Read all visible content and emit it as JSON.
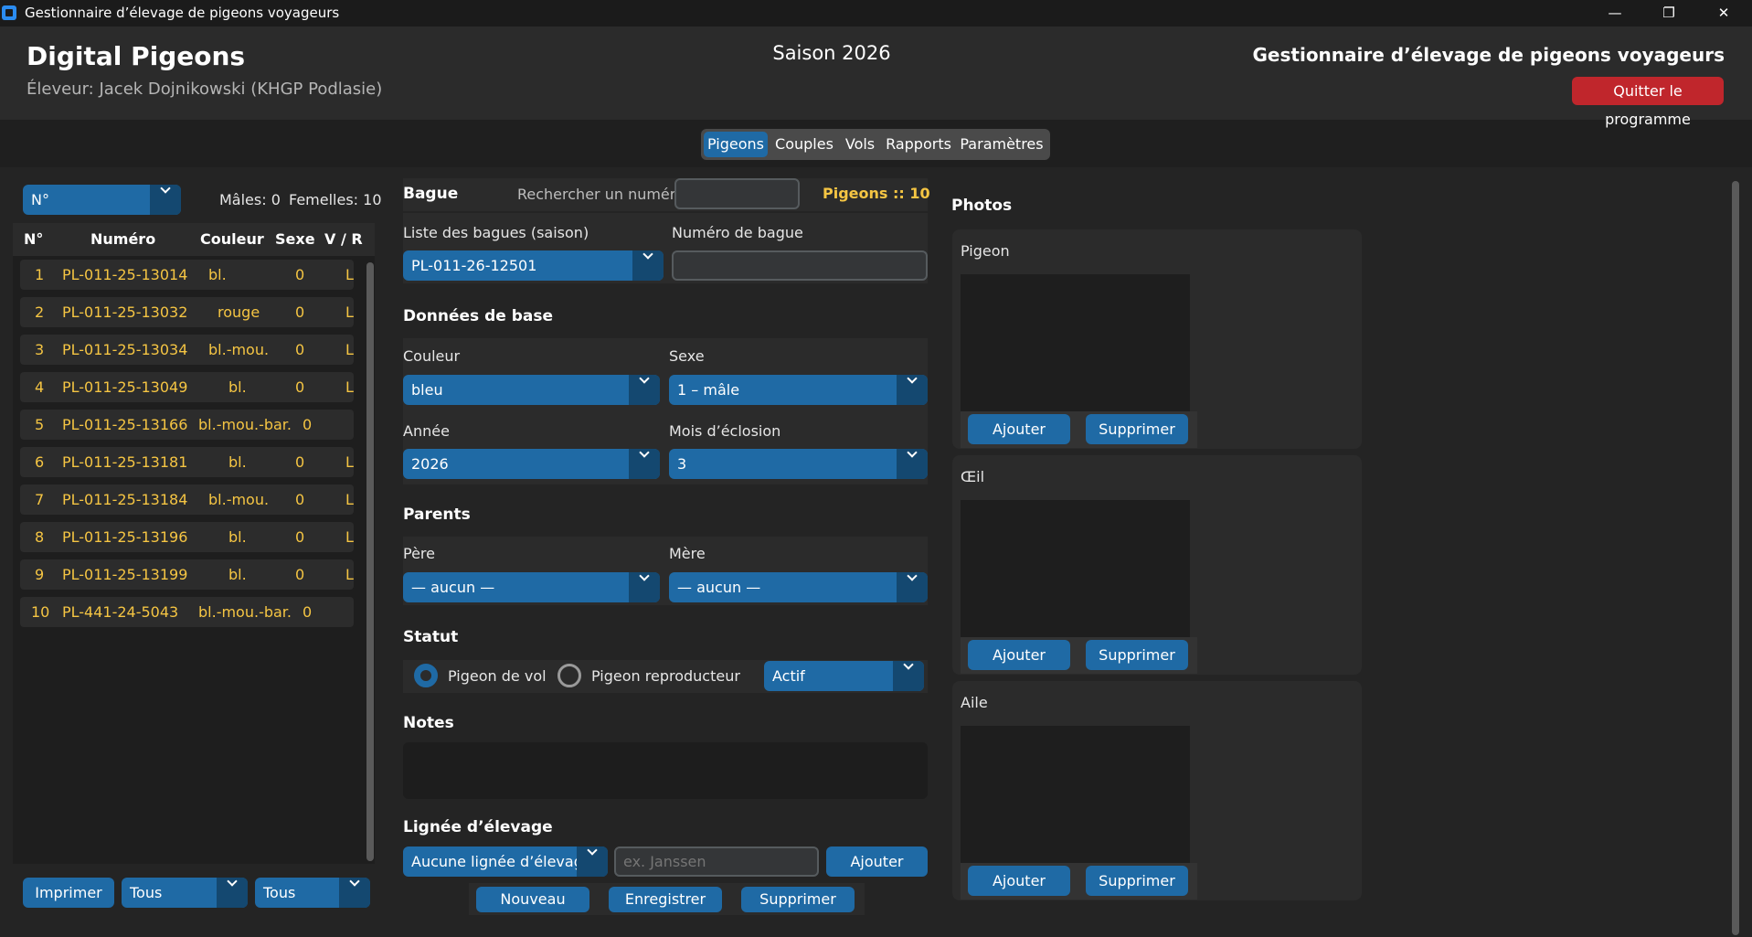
{
  "window": {
    "title": "Gestionnaire d’élevage de pigeons voyageurs",
    "min": "—",
    "max": "❐",
    "close": "✕"
  },
  "header": {
    "app_name": "Digital Pigeons",
    "breeder": "Éleveur: Jacek Dojnikowski (KHGP Podlasie)",
    "season": "Saison 2026",
    "app_subtitle": "Gestionnaire d’élevage de pigeons voyageurs",
    "quit_label": "Quitter le programme"
  },
  "tabs": [
    {
      "label": "Pigeons",
      "active": true
    },
    {
      "label": "Couples",
      "active": false
    },
    {
      "label": "Vols",
      "active": false
    },
    {
      "label": "Rapports",
      "active": false
    },
    {
      "label": "Paramètres",
      "active": false
    }
  ],
  "list": {
    "sort_value": "N°",
    "males": "Mâles: 0",
    "females": "Femelles: 10",
    "columns": [
      "N°",
      "Numéro",
      "Couleur",
      "Sexe",
      "V / R"
    ],
    "rows": [
      {
        "n": "1",
        "numero": "PL-011-25-13014",
        "couleur": "bl.",
        "sexe": "0",
        "vr": "L"
      },
      {
        "n": "2",
        "numero": "PL-011-25-13032",
        "couleur": "rouge",
        "sexe": "0",
        "vr": "L"
      },
      {
        "n": "3",
        "numero": "PL-011-25-13034",
        "couleur": "bl.-mou.",
        "sexe": "0",
        "vr": "L"
      },
      {
        "n": "4",
        "numero": "PL-011-25-13049",
        "couleur": "bl.",
        "sexe": "0",
        "vr": "L"
      },
      {
        "n": "5",
        "numero": "PL-011-25-13166",
        "couleur": "bl.-mou.-bar.",
        "sexe": "0",
        "vr": ""
      },
      {
        "n": "6",
        "numero": "PL-011-25-13181",
        "couleur": "bl.",
        "sexe": "0",
        "vr": "L"
      },
      {
        "n": "7",
        "numero": "PL-011-25-13184",
        "couleur": "bl.-mou.",
        "sexe": "0",
        "vr": "L"
      },
      {
        "n": "8",
        "numero": "PL-011-25-13196",
        "couleur": "bl.",
        "sexe": "0",
        "vr": "L"
      },
      {
        "n": "9",
        "numero": "PL-011-25-13199",
        "couleur": "bl.",
        "sexe": "0",
        "vr": "L"
      },
      {
        "n": "10",
        "numero": "PL-441-24-5043",
        "couleur": "bl.-mou.-bar.",
        "sexe": "0",
        "vr": ""
      }
    ],
    "print_label": "Imprimer",
    "filter1_value": "Tous",
    "filter2_value": "Tous"
  },
  "form": {
    "bague_section": "Bague",
    "search_label": "Rechercher un numéro :",
    "search_value": "",
    "pigeons_count": "Pigeons :: 10",
    "ring_list_label": "Liste des bagues (saison)",
    "ring_list_value": "PL-011-26-12501",
    "ring_number_label": "Numéro de bague",
    "ring_number_value": "",
    "base_section": "Données de base",
    "color_label": "Couleur",
    "color_value": "bleu",
    "sex_label": "Sexe",
    "sex_value": "1 – mâle",
    "year_label": "Année",
    "year_value": "2026",
    "hatch_label": "Mois d’éclosion",
    "hatch_value": "3",
    "parents_section": "Parents",
    "father_label": "Père",
    "father_value": "— aucun —",
    "mother_label": "Mère",
    "mother_value": "— aucun —",
    "status_section": "Statut",
    "radio_flight": "Pigeon de vol",
    "radio_breeder": "Pigeon reproducteur",
    "status_value": "Actif",
    "notes_section": "Notes",
    "notes_value": "",
    "lineage_section": "Lignée d’élevage",
    "lineage_value": "Aucune lignée d’élevage",
    "lineage_placeholder": "ex. Janssen",
    "lineage_add": "Ajouter",
    "new_label": "Nouveau",
    "save_label": "Enregistrer",
    "delete_label": "Supprimer"
  },
  "photos": {
    "title": "Photos",
    "cards": [
      {
        "label": "Pigeon",
        "add": "Ajouter",
        "delete": "Supprimer"
      },
      {
        "label": "Œil",
        "add": "Ajouter",
        "delete": "Supprimer"
      },
      {
        "label": "Aile",
        "add": "Ajouter",
        "delete": "Supprimer"
      }
    ]
  },
  "colors": {
    "accent": "#1f6aa5",
    "accent_dark": "#144870",
    "danger": "#c0262c",
    "highlight": "#f5c543"
  }
}
